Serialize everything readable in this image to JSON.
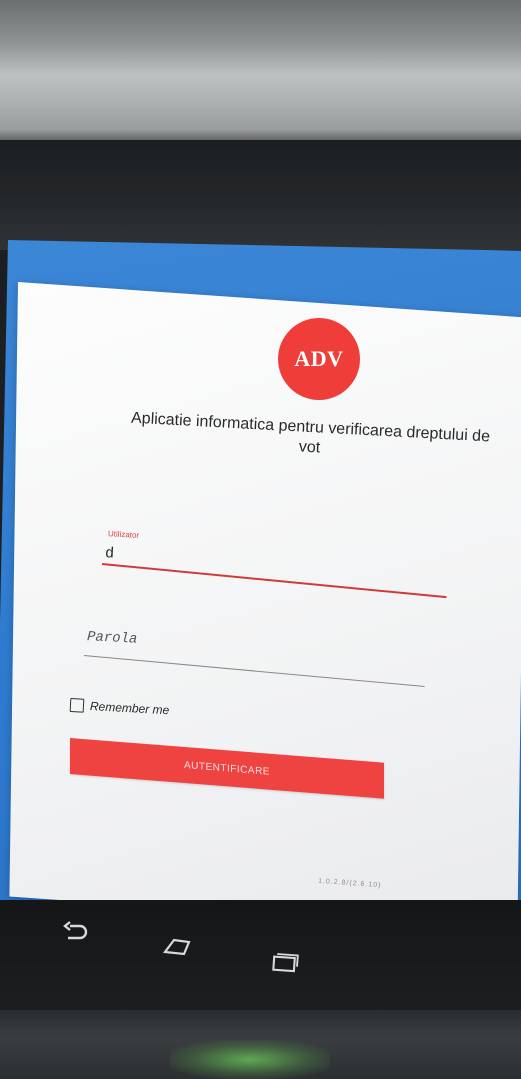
{
  "logo": {
    "text": "ADV"
  },
  "app_title": "Aplicatie informatica pentru verificarea dreptului de vot",
  "username": {
    "label": "Utilizator",
    "value": "d"
  },
  "password": {
    "placeholder": "Parola"
  },
  "remember_me": {
    "label": "Remember me",
    "checked": false
  },
  "login_button": {
    "label": "AUTENTIFICARE"
  },
  "version": "1.0.2.8/(2.6.10)",
  "nav": {
    "back_icon": "back-icon",
    "home_icon": "home-icon",
    "recents_icon": "recents-icon"
  },
  "colors": {
    "accent": "#ee4340",
    "background": "#2f7bd0",
    "card": "#f5f5f5"
  }
}
